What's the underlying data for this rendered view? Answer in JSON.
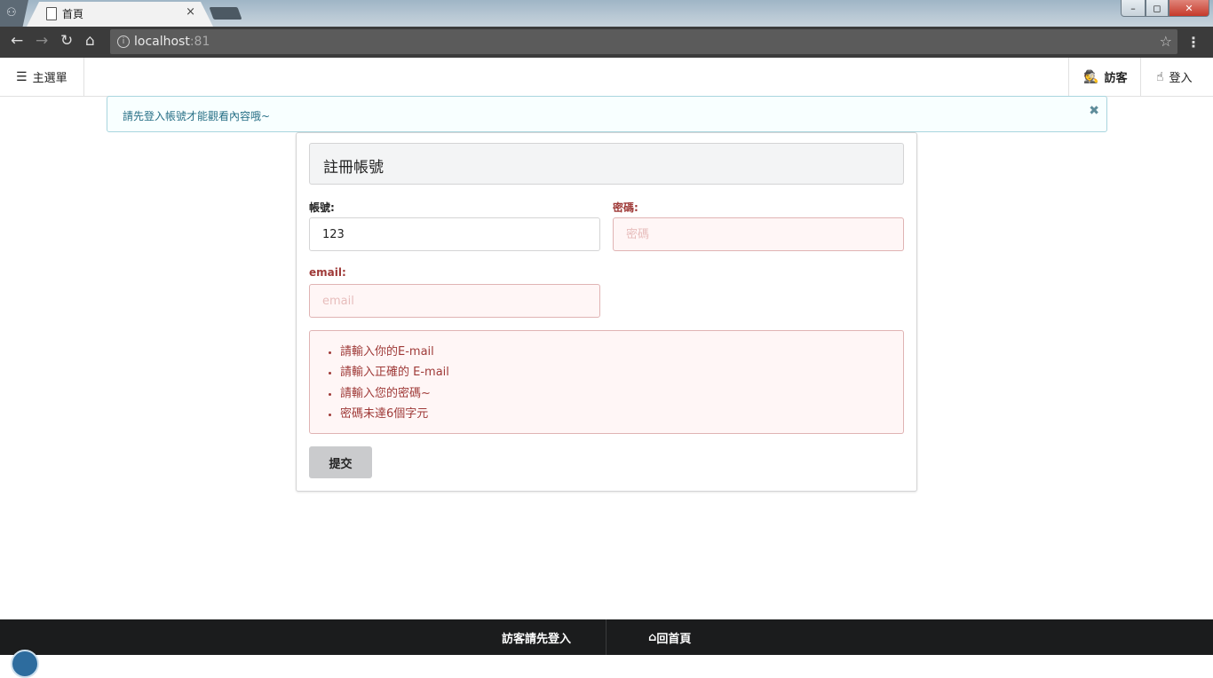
{
  "browser": {
    "tab_title": "首頁",
    "tab_close": "×",
    "url_host": "localhost",
    "url_port": ":81",
    "window_buttons": {
      "minimize": "–",
      "maximize": "◻",
      "close": "✕"
    }
  },
  "nav": {
    "menu_label": "主選單",
    "guest_label": "訪客",
    "login_label": "登入"
  },
  "alert": {
    "message": "請先登入帳號才能觀看內容哦~",
    "close": "✖"
  },
  "form": {
    "title": "註冊帳號",
    "account": {
      "label": "帳號:",
      "value": "123"
    },
    "password": {
      "label": "密碼:",
      "placeholder": "密碼"
    },
    "email": {
      "label": "email:",
      "placeholder": "email"
    },
    "errors": [
      "請輸入你的E-mail",
      "請輸入正確的 E-mail",
      "請輸入您的密碼~",
      "密碼未達6個字元"
    ],
    "submit_label": "提交"
  },
  "footer": {
    "guest_notice": "訪客請先登入",
    "home_label": "回首頁"
  },
  "colors": {
    "error_text": "#9f3a38",
    "error_bg": "#fff6f6",
    "info_text": "#276f86",
    "footer_bg": "#1b1c1d"
  },
  "icons": {
    "menu": "bars-icon",
    "guest": "user-secret-icon",
    "login": "hand-pointer-icon",
    "home": "home-icon"
  }
}
